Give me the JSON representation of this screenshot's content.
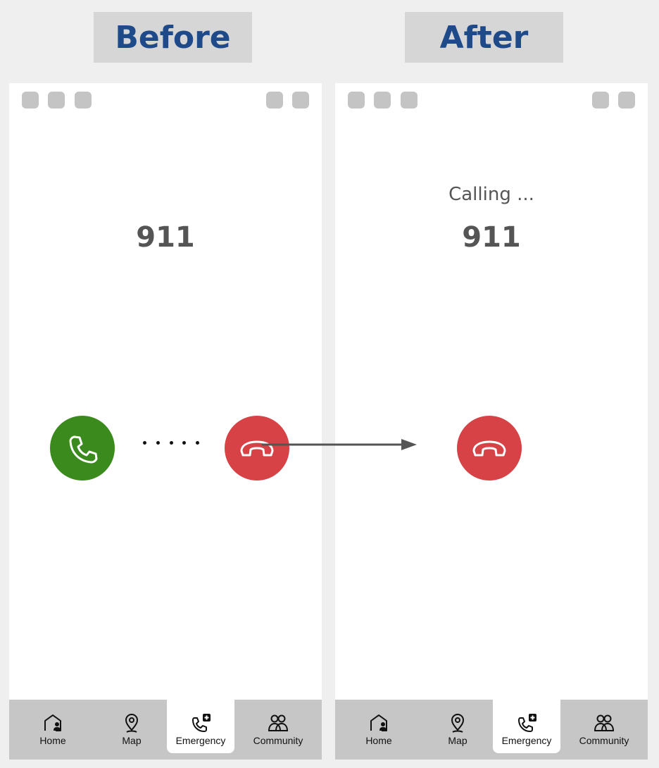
{
  "titles": {
    "before": "Before",
    "after": "After"
  },
  "before": {
    "number": "911"
  },
  "after": {
    "status": "Calling ...",
    "number": "911"
  },
  "nav": {
    "home": "Home",
    "map": "Map",
    "emergency": "Emergency",
    "community": "Community",
    "active": "Emergency"
  },
  "colors": {
    "title": "#1f4a8a",
    "accept": "#3a8a1e",
    "decline": "#d64245",
    "navbar": "#c6c6c6"
  },
  "icons": [
    "phone-icon",
    "hang-up-icon",
    "home-icon",
    "map-pin-icon",
    "emergency-call-icon",
    "community-icon"
  ]
}
